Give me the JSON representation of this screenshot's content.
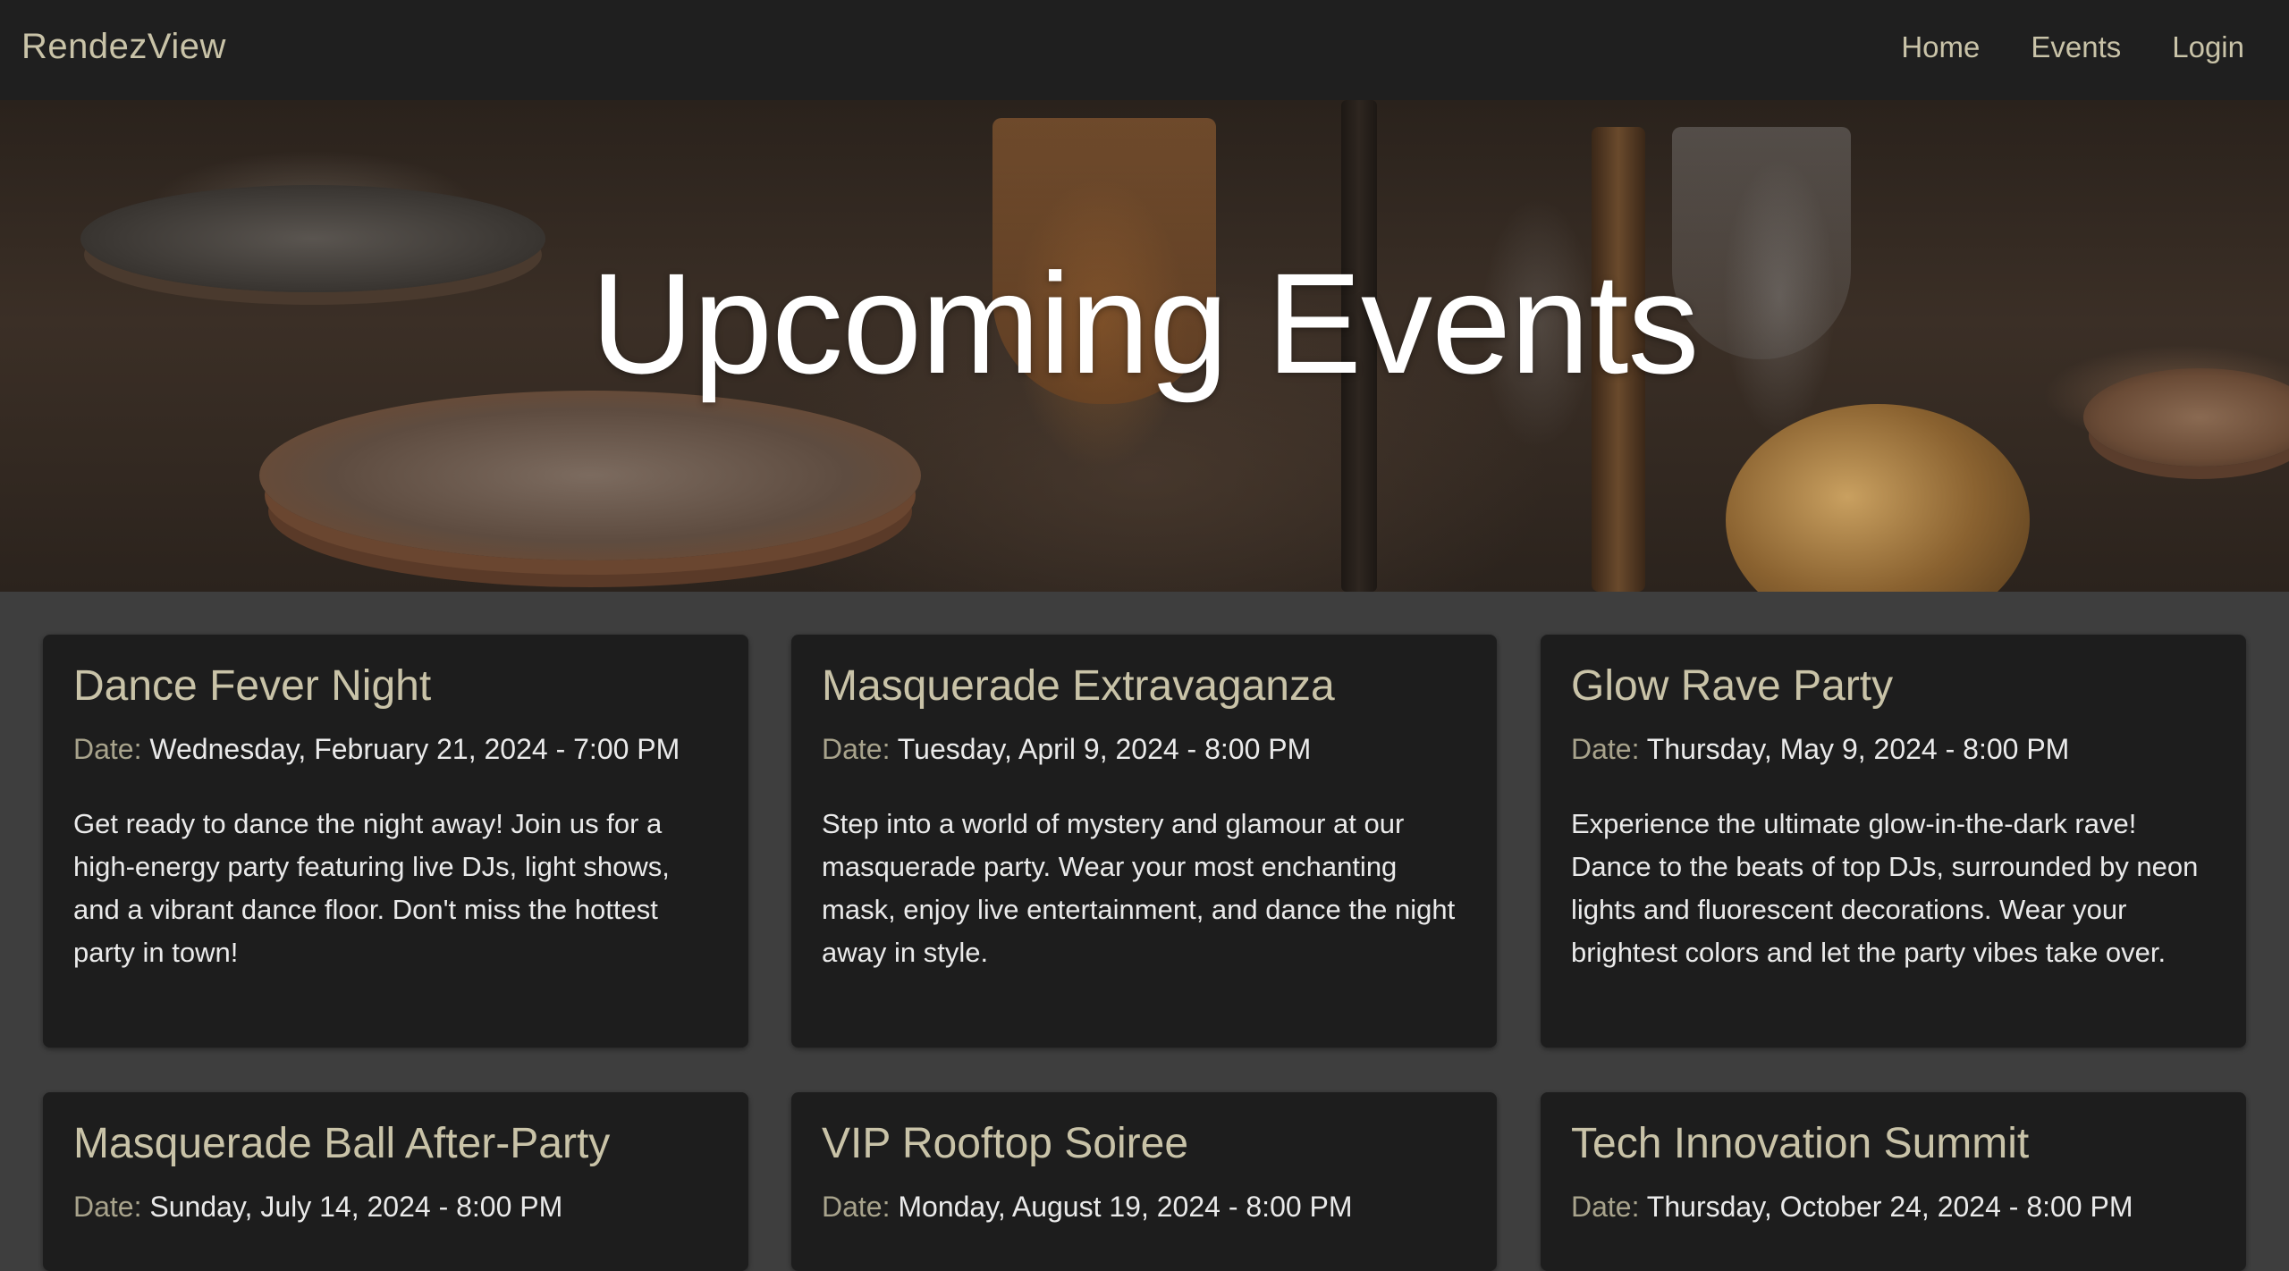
{
  "nav": {
    "brand": "RendezView",
    "links": [
      "Home",
      "Events",
      "Login"
    ]
  },
  "hero": {
    "title": "Upcoming Events"
  },
  "events": [
    {
      "title": "Dance Fever Night",
      "date_label": "Date:",
      "date": "Wednesday, February 21, 2024 - 7:00 PM",
      "description": "Get ready to dance the night away! Join us for a high-energy party featuring live DJs, light shows, and a vibrant dance floor. Don't miss the hottest party in town!"
    },
    {
      "title": "Masquerade Extravaganza",
      "date_label": "Date:",
      "date": "Tuesday, April 9, 2024 - 8:00 PM",
      "description": "Step into a world of mystery and glamour at our masquerade party. Wear your most enchanting mask, enjoy live entertainment, and dance the night away in style."
    },
    {
      "title": "Glow Rave Party",
      "date_label": "Date:",
      "date": "Thursday, May 9, 2024 - 8:00 PM",
      "description": "Experience the ultimate glow-in-the-dark rave! Dance to the beats of top DJs, surrounded by neon lights and fluorescent decorations. Wear your brightest colors and let the party vibes take over."
    },
    {
      "title": "Masquerade Ball After-Party",
      "date_label": "Date:",
      "date": "Sunday, July 14, 2024 - 8:00 PM",
      "description": ""
    },
    {
      "title": "VIP Rooftop Soiree",
      "date_label": "Date:",
      "date": "Monday, August 19, 2024 - 8:00 PM",
      "description": ""
    },
    {
      "title": "Tech Innovation Summit",
      "date_label": "Date:",
      "date": "Thursday, October 24, 2024 - 8:00 PM",
      "description": ""
    }
  ]
}
